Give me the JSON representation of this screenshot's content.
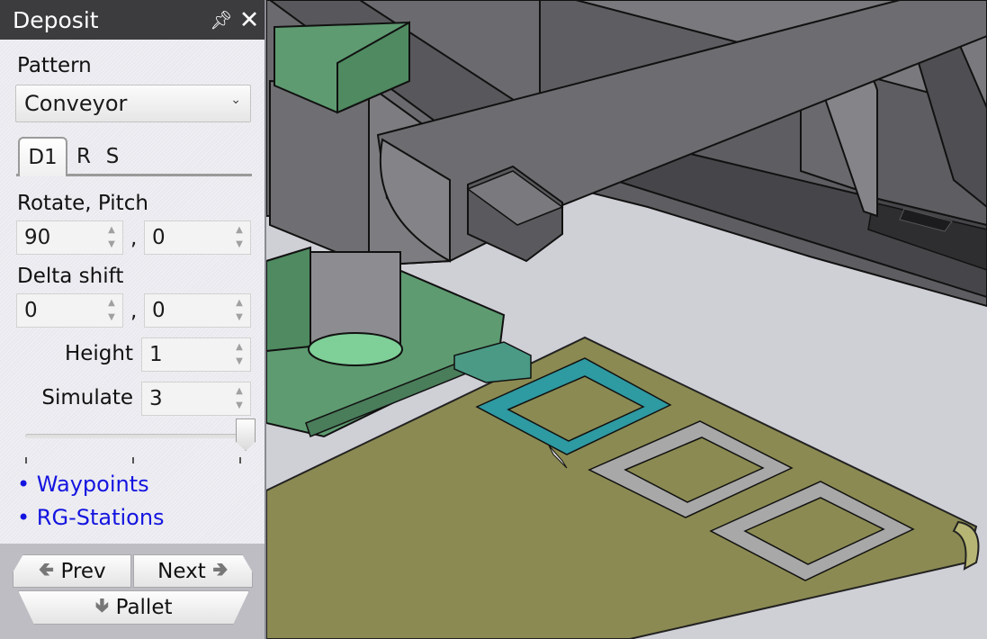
{
  "panel": {
    "title": "Deposit",
    "pin_icon": "pin-icon",
    "close_icon": "close-icon",
    "pattern_label": "Pattern",
    "pattern_value": "Conveyor",
    "tabs": [
      "D1",
      "R",
      "S"
    ],
    "active_tab": "D1",
    "rotate_pitch_label": "Rotate, Pitch",
    "rotate_value": "90",
    "pitch_value": "0",
    "delta_shift_label": "Delta shift",
    "delta_x_value": "0",
    "delta_y_value": "0",
    "comma": ",",
    "height_label": "Height",
    "height_value": "1",
    "simulate_label": "Simulate",
    "simulate_value": "3",
    "slider_position": 1.0,
    "bullet": "•",
    "links": [
      "Waypoints",
      "RG-Stations"
    ],
    "nav": {
      "prev_label": "Prev",
      "next_label": "Next",
      "pallet_label": "Pallet"
    }
  },
  "colors": {
    "title_bar": "#3c3c3f",
    "link": "#1414e0",
    "conveyor_belt": "#8b8a52",
    "gripper_green": "#5e9b71",
    "selected_pad": "#2e9aa2",
    "pad_grey": "#a8a8a8"
  }
}
